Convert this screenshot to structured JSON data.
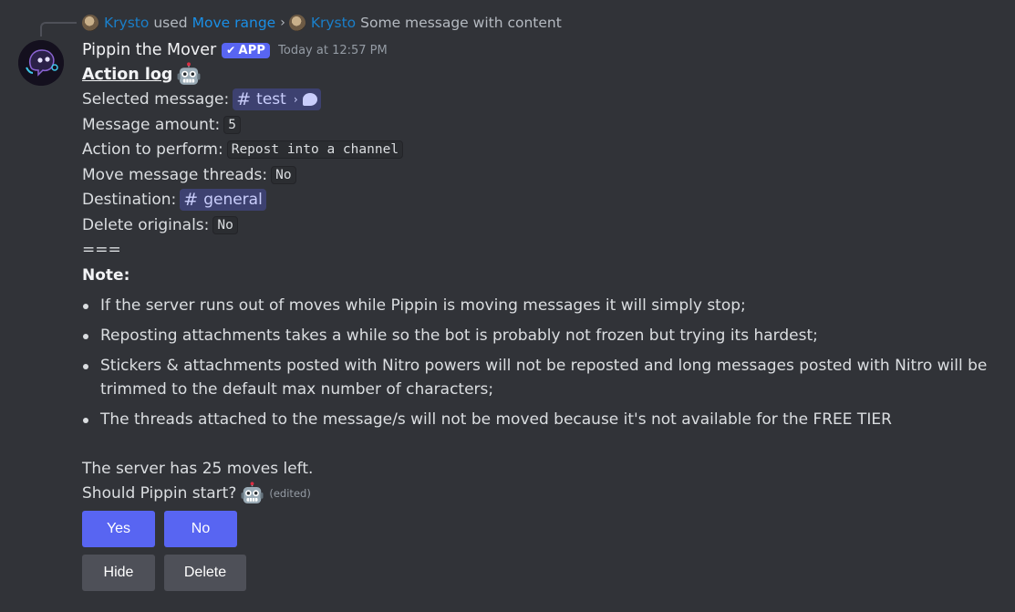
{
  "reply": {
    "user": "Krysto",
    "used_text": "used",
    "command": "Move range",
    "separator": "›",
    "user2": "Krysto",
    "preview": "Some message with content"
  },
  "message": {
    "author": "Pippin the Mover",
    "app_tag": "APP",
    "timestamp": "Today at 12:57 PM",
    "title": "Action log",
    "fields": {
      "selected_label": "Selected message:",
      "selected_channel": "test",
      "amount_label": "Message amount:",
      "amount_value": "5",
      "action_label": "Action to perform:",
      "action_value": "Repost into a channel",
      "threads_label": "Move message threads:",
      "threads_value": "No",
      "destination_label": "Destination:",
      "destination_channel": "general",
      "delete_label": "Delete originals:",
      "delete_value": "No"
    },
    "separator": "===",
    "note_heading": "Note:",
    "notes": [
      "If the server runs out of moves while Pippin is moving messages it will simply stop;",
      "Reposting attachments takes a while so the bot is probably not frozen but trying its hardest;",
      "Stickers & attachments posted with Nitro powers will not be reposted and long messages posted with Nitro will be trimmed to the default max number of characters;",
      "The threads attached to the message/s will not be moved because it's not available for the FREE TIER"
    ],
    "moves_left": "The server has 25 moves left.",
    "question": "Should Pippin start?",
    "edited": "(edited)"
  },
  "buttons": {
    "yes": "Yes",
    "no": "No",
    "hide": "Hide",
    "delete": "Delete"
  },
  "icons": {
    "robot": "robot-face-emoji",
    "check": "check-icon",
    "hash": "channel-hash-icon",
    "thread": "thread-bubble-icon"
  },
  "colors": {
    "background": "#313338",
    "blurple": "#5865f2",
    "secondary_button": "#4e5058",
    "link": "#1a8fe6"
  }
}
